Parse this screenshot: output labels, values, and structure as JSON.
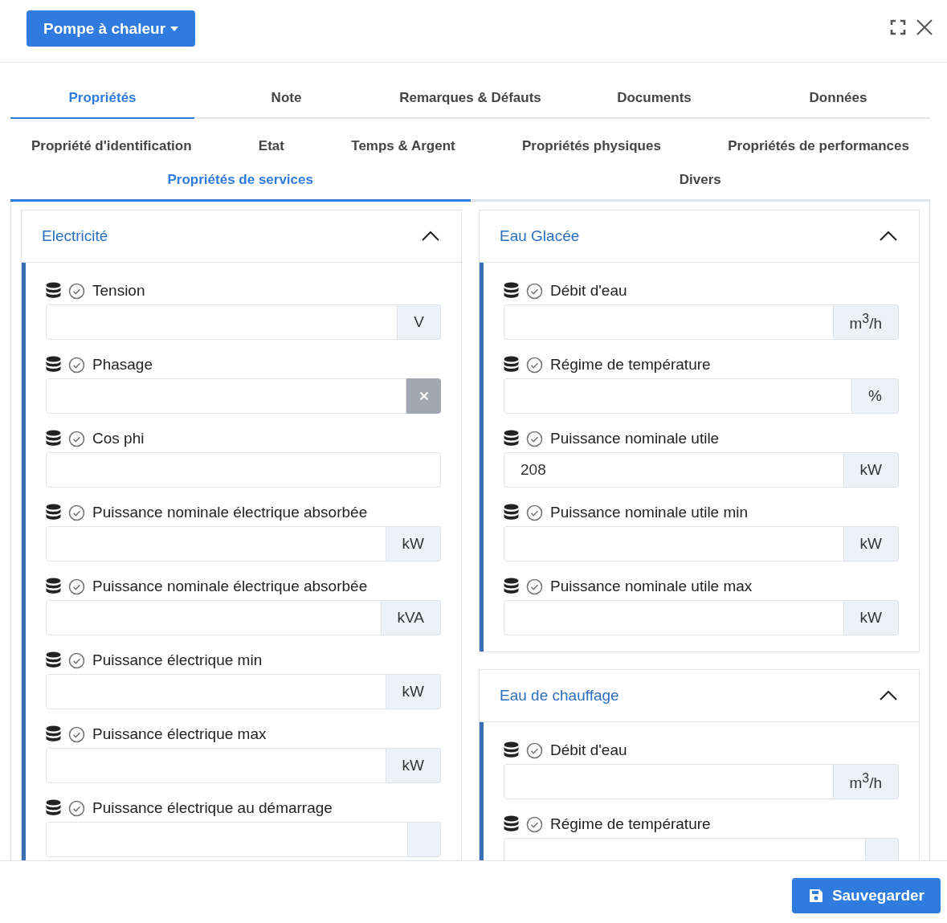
{
  "header": {
    "menu_button": "Pompe à chaleur"
  },
  "tabs": [
    {
      "label": "Propriétés",
      "selected": true
    },
    {
      "label": "Note",
      "selected": false
    },
    {
      "label": "Remarques & Défauts",
      "selected": false
    },
    {
      "label": "Documents",
      "selected": false
    },
    {
      "label": "Données",
      "selected": false
    }
  ],
  "subtabs": [
    {
      "label": "Propriété d'identification",
      "selected": false
    },
    {
      "label": "Etat",
      "selected": false
    },
    {
      "label": "Temps & Argent",
      "selected": false
    },
    {
      "label": "Propriétés physiques",
      "selected": false
    },
    {
      "label": "Propriétés de performances",
      "selected": false
    },
    {
      "label": "Propriétés de services",
      "selected": true
    },
    {
      "label": "Divers",
      "selected": false
    }
  ],
  "columns": [
    [
      {
        "title": "Electricité",
        "expanded": true,
        "fields": [
          {
            "label": "Tension",
            "kind": "unit",
            "unit": "V"
          },
          {
            "label": "Phasage",
            "kind": "clear"
          },
          {
            "label": "Cos phi",
            "kind": "plain"
          },
          {
            "label": "Puissance nominale électrique absorbée",
            "kind": "unit",
            "unit": "kW"
          },
          {
            "label": "Puissance nominale électrique absorbée",
            "kind": "unit",
            "unit": "kVA"
          },
          {
            "label": "Puissance électrique min",
            "kind": "unit",
            "unit": "kW"
          },
          {
            "label": "Puissance électrique max",
            "kind": "unit",
            "unit": "kW"
          },
          {
            "label": "Puissance électrique au démarrage",
            "kind": "unit"
          }
        ]
      }
    ],
    [
      {
        "title": "Eau Glacée",
        "expanded": true,
        "fields": [
          {
            "label": "Débit d'eau",
            "kind": "unit",
            "unit": "m$^{3}$/h"
          },
          {
            "label": "Régime de température",
            "kind": "unit",
            "unit": "%"
          },
          {
            "label": "Puissance nominale utile",
            "kind": "unit",
            "unit": "kW",
            "value": "208"
          },
          {
            "label": "Puissance nominale utile min",
            "kind": "unit",
            "unit": "kW"
          },
          {
            "label": "Puissance nominale utile max",
            "kind": "unit",
            "unit": "kW"
          }
        ]
      },
      {
        "title": "Eau de chauffage",
        "expanded": true,
        "fields": [
          {
            "label": "Débit d'eau",
            "kind": "unit",
            "unit": "m$^{3}$/h"
          },
          {
            "label": "Régime de température",
            "kind": "unit"
          }
        ]
      }
    ]
  ],
  "footer": {
    "save_button": "Sauvegarder"
  }
}
